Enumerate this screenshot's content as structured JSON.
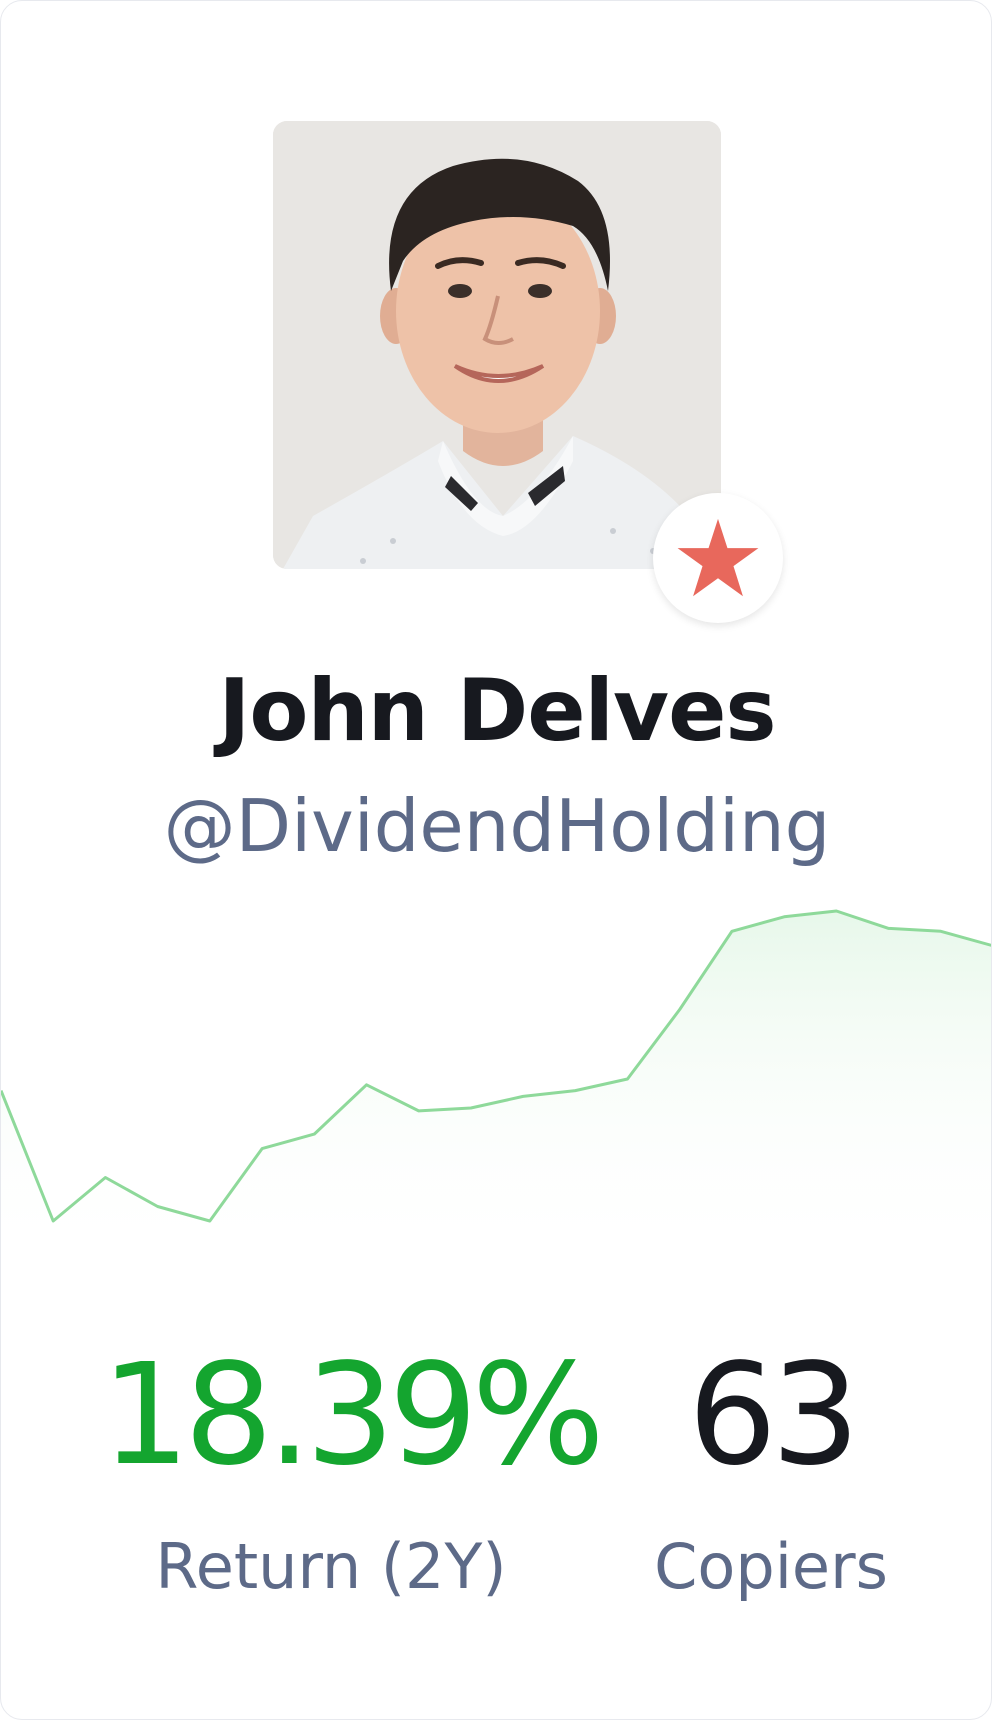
{
  "trader": {
    "name": "John Delves",
    "handle": "@DividendHolding",
    "badge_icon": "star-icon"
  },
  "stats": {
    "return_value": "18.39%",
    "return_label": "Return (2Y)",
    "copiers_value": "63",
    "copiers_label": "Copiers"
  },
  "colors": {
    "positive": "#14a52f",
    "badge_star": "#e8685c",
    "chart_line": "#8ed99a"
  },
  "chart_data": {
    "type": "area",
    "values": [
      0.4,
      -0.05,
      0.1,
      0.0,
      -0.05,
      0.2,
      0.25,
      0.42,
      0.33,
      0.34,
      0.38,
      0.4,
      0.44,
      0.68,
      0.95,
      1.0,
      1.02,
      0.96,
      0.95,
      0.9
    ],
    "title": "",
    "xlabel": "",
    "ylabel": "",
    "grid": false
  }
}
